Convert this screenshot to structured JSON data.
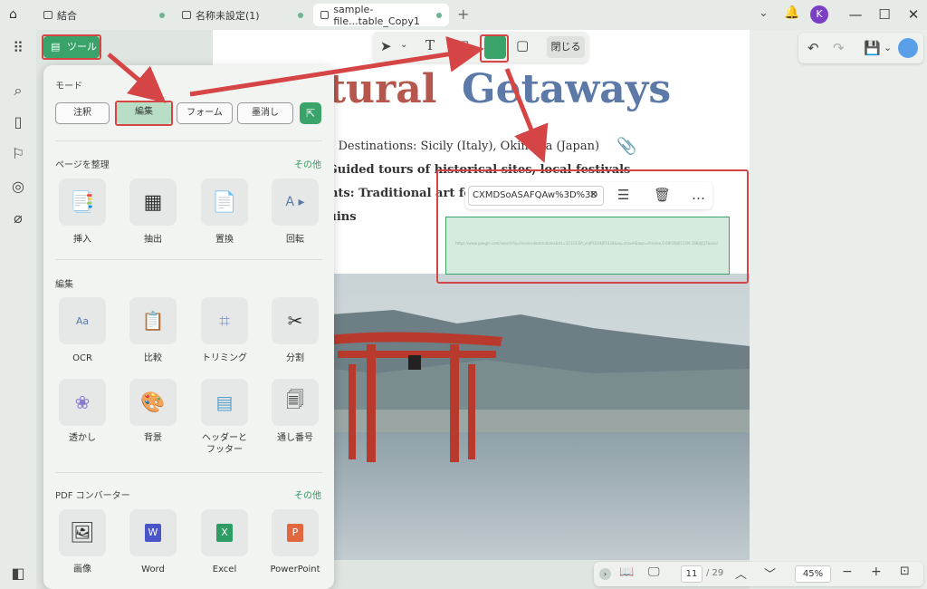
{
  "tabs": [
    {
      "label": "結合"
    },
    {
      "label": "名称未設定(1)"
    },
    {
      "label": "sample-file...table_Copy1"
    }
  ],
  "user_initial": "K",
  "tools_button": "ツール",
  "mode": {
    "title": "モード",
    "buttons": [
      "注釈",
      "編集",
      "フォーム",
      "墨消し"
    ]
  },
  "organize": {
    "title": "ページを整理",
    "more": "その他",
    "items": [
      "挿入",
      "抽出",
      "置換",
      "回転"
    ]
  },
  "edit": {
    "title": "編集",
    "items": [
      "OCR",
      "比較",
      "トリミング",
      "分割",
      "透かし",
      "背景",
      "ヘッダーと\nフッター",
      "通し番号"
    ]
  },
  "converter": {
    "title": "PDF コンバーター",
    "more": "その他",
    "items": [
      "画像",
      "Word",
      "Excel",
      "PowerPoint"
    ]
  },
  "toolbar": {
    "close_label": "閉じる"
  },
  "doc": {
    "heading_red": "ltural",
    "heading_blue": "Getaways",
    "lines": [
      "ded Destinations: Sicily (Italy), Okinawa (Japan)",
      "s: Guided tours of historical sites, local festivals",
      "lights: Traditional art fo",
      "t ruins"
    ]
  },
  "link": {
    "url_chip": "CXMDSoASAFQAw%3D%3D",
    "url_text": "https://www.google.com/search?q=travel+destinations&rlz=1C1GCEA_enJP1034JP1034&oq=travel&aqs=chrome.0.69i59j0i512l9.1684j0j7&sourceid=chrome&ie=UTF-8"
  },
  "status": {
    "page": "11",
    "total": "/ 29",
    "zoom": "45%"
  },
  "colors": {
    "accent": "#3aa36a",
    "red": "#d64545",
    "heading_red": "#b5574c",
    "heading_blue": "#5c79a8"
  }
}
